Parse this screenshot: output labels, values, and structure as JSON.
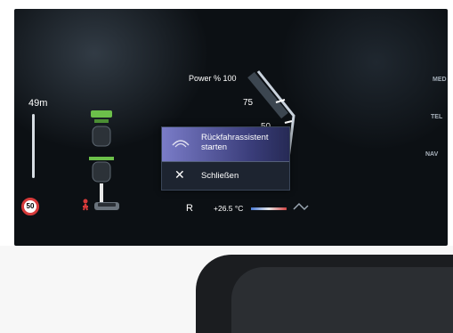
{
  "cluster": {
    "distance": "49m",
    "power_label": "Power % 100",
    "gauge_ticks": [
      "75",
      "50"
    ],
    "gear": "R",
    "temperature": "+26.5 °C",
    "speed_limit": "50",
    "right_menu": [
      "MED",
      "TEL",
      "NAV"
    ]
  },
  "popup": {
    "start_label": "Rückfahrassistent starten",
    "close_label": "Schließen",
    "icon_start": "reverse-assist-icon",
    "icon_close": "close-icon"
  },
  "colors": {
    "popup_highlight": "#7a7cc8",
    "lane_green": "#6cc04a",
    "warning_red": "#d63a3a"
  }
}
